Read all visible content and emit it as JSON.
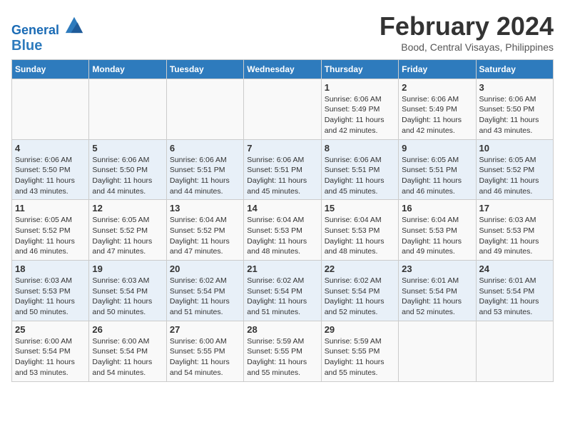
{
  "header": {
    "logo_line1": "General",
    "logo_line2": "Blue",
    "title": "February 2024",
    "subtitle": "Bood, Central Visayas, Philippines"
  },
  "columns": [
    "Sunday",
    "Monday",
    "Tuesday",
    "Wednesday",
    "Thursday",
    "Friday",
    "Saturday"
  ],
  "weeks": [
    [
      {
        "day": "",
        "info": ""
      },
      {
        "day": "",
        "info": ""
      },
      {
        "day": "",
        "info": ""
      },
      {
        "day": "",
        "info": ""
      },
      {
        "day": "1",
        "info": "Sunrise: 6:06 AM\nSunset: 5:49 PM\nDaylight: 11 hours and 42 minutes."
      },
      {
        "day": "2",
        "info": "Sunrise: 6:06 AM\nSunset: 5:49 PM\nDaylight: 11 hours and 42 minutes."
      },
      {
        "day": "3",
        "info": "Sunrise: 6:06 AM\nSunset: 5:50 PM\nDaylight: 11 hours and 43 minutes."
      }
    ],
    [
      {
        "day": "4",
        "info": "Sunrise: 6:06 AM\nSunset: 5:50 PM\nDaylight: 11 hours and 43 minutes."
      },
      {
        "day": "5",
        "info": "Sunrise: 6:06 AM\nSunset: 5:50 PM\nDaylight: 11 hours and 44 minutes."
      },
      {
        "day": "6",
        "info": "Sunrise: 6:06 AM\nSunset: 5:51 PM\nDaylight: 11 hours and 44 minutes."
      },
      {
        "day": "7",
        "info": "Sunrise: 6:06 AM\nSunset: 5:51 PM\nDaylight: 11 hours and 45 minutes."
      },
      {
        "day": "8",
        "info": "Sunrise: 6:06 AM\nSunset: 5:51 PM\nDaylight: 11 hours and 45 minutes."
      },
      {
        "day": "9",
        "info": "Sunrise: 6:05 AM\nSunset: 5:51 PM\nDaylight: 11 hours and 46 minutes."
      },
      {
        "day": "10",
        "info": "Sunrise: 6:05 AM\nSunset: 5:52 PM\nDaylight: 11 hours and 46 minutes."
      }
    ],
    [
      {
        "day": "11",
        "info": "Sunrise: 6:05 AM\nSunset: 5:52 PM\nDaylight: 11 hours and 46 minutes."
      },
      {
        "day": "12",
        "info": "Sunrise: 6:05 AM\nSunset: 5:52 PM\nDaylight: 11 hours and 47 minutes."
      },
      {
        "day": "13",
        "info": "Sunrise: 6:04 AM\nSunset: 5:52 PM\nDaylight: 11 hours and 47 minutes."
      },
      {
        "day": "14",
        "info": "Sunrise: 6:04 AM\nSunset: 5:53 PM\nDaylight: 11 hours and 48 minutes."
      },
      {
        "day": "15",
        "info": "Sunrise: 6:04 AM\nSunset: 5:53 PM\nDaylight: 11 hours and 48 minutes."
      },
      {
        "day": "16",
        "info": "Sunrise: 6:04 AM\nSunset: 5:53 PM\nDaylight: 11 hours and 49 minutes."
      },
      {
        "day": "17",
        "info": "Sunrise: 6:03 AM\nSunset: 5:53 PM\nDaylight: 11 hours and 49 minutes."
      }
    ],
    [
      {
        "day": "18",
        "info": "Sunrise: 6:03 AM\nSunset: 5:53 PM\nDaylight: 11 hours and 50 minutes."
      },
      {
        "day": "19",
        "info": "Sunrise: 6:03 AM\nSunset: 5:54 PM\nDaylight: 11 hours and 50 minutes."
      },
      {
        "day": "20",
        "info": "Sunrise: 6:02 AM\nSunset: 5:54 PM\nDaylight: 11 hours and 51 minutes."
      },
      {
        "day": "21",
        "info": "Sunrise: 6:02 AM\nSunset: 5:54 PM\nDaylight: 11 hours and 51 minutes."
      },
      {
        "day": "22",
        "info": "Sunrise: 6:02 AM\nSunset: 5:54 PM\nDaylight: 11 hours and 52 minutes."
      },
      {
        "day": "23",
        "info": "Sunrise: 6:01 AM\nSunset: 5:54 PM\nDaylight: 11 hours and 52 minutes."
      },
      {
        "day": "24",
        "info": "Sunrise: 6:01 AM\nSunset: 5:54 PM\nDaylight: 11 hours and 53 minutes."
      }
    ],
    [
      {
        "day": "25",
        "info": "Sunrise: 6:00 AM\nSunset: 5:54 PM\nDaylight: 11 hours and 53 minutes."
      },
      {
        "day": "26",
        "info": "Sunrise: 6:00 AM\nSunset: 5:54 PM\nDaylight: 11 hours and 54 minutes."
      },
      {
        "day": "27",
        "info": "Sunrise: 6:00 AM\nSunset: 5:55 PM\nDaylight: 11 hours and 54 minutes."
      },
      {
        "day": "28",
        "info": "Sunrise: 5:59 AM\nSunset: 5:55 PM\nDaylight: 11 hours and 55 minutes."
      },
      {
        "day": "29",
        "info": "Sunrise: 5:59 AM\nSunset: 5:55 PM\nDaylight: 11 hours and 55 minutes."
      },
      {
        "day": "",
        "info": ""
      },
      {
        "day": "",
        "info": ""
      }
    ]
  ]
}
